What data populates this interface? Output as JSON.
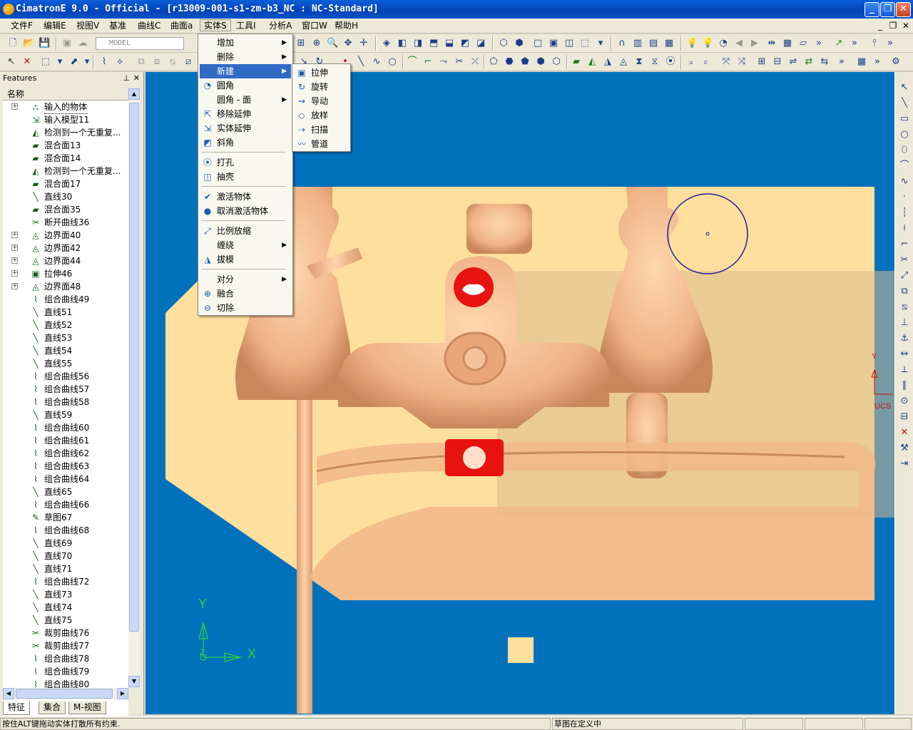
{
  "window": {
    "title": "CimatronE 9.0 - Official - [r13009-001-s1-zm-b3_NC : NC-Standard]",
    "minimize": "_",
    "restore": "❐",
    "close": "✕"
  },
  "menubar": {
    "items": [
      "文件F",
      "编辑E",
      "视图V",
      "基准",
      "曲线C",
      "曲面a",
      "实体S",
      "工具I",
      "分析A",
      "窗口W",
      "帮助H"
    ],
    "mdi_min": "_",
    "mdi_restore": "❐",
    "mdi_close": "✕"
  },
  "toolbar": {
    "model_combo": "MODEL"
  },
  "features": {
    "title": "Features",
    "pin": "⊥",
    "close": "✕",
    "column": "名称",
    "tree": [
      {
        "label": "输入的物体",
        "icon": "input-body-icon",
        "expander": "+"
      },
      {
        "label": "输入模型11",
        "icon": "input-model-icon",
        "expander": ""
      },
      {
        "label": "检测到一个无重复...",
        "icon": "detect-icon",
        "expander": ""
      },
      {
        "label": "混合面13",
        "icon": "blend-surface-icon",
        "expander": ""
      },
      {
        "label": "混合面14",
        "icon": "blend-surface-icon",
        "expander": ""
      },
      {
        "label": "检测到一个无重复...",
        "icon": "detect-icon",
        "expander": ""
      },
      {
        "label": "混合面17",
        "icon": "blend-surface-icon",
        "expander": ""
      },
      {
        "label": "直线30",
        "icon": "line-icon",
        "expander": ""
      },
      {
        "label": "混合面35",
        "icon": "blend-surface-icon",
        "expander": ""
      },
      {
        "label": "断开曲线36",
        "icon": "break-curve-icon",
        "expander": ""
      },
      {
        "label": "边界面40",
        "icon": "boundary-surface-icon",
        "expander": "+"
      },
      {
        "label": "边界面42",
        "icon": "boundary-surface-icon",
        "expander": "+"
      },
      {
        "label": "边界面44",
        "icon": "boundary-surface-icon",
        "expander": "+"
      },
      {
        "label": "拉伸46",
        "icon": "extrude-icon",
        "expander": "+"
      },
      {
        "label": "边界面48",
        "icon": "boundary-surface-icon",
        "expander": "+"
      },
      {
        "label": "组合曲线49",
        "icon": "composite-curve-icon",
        "expander": ""
      },
      {
        "label": "直线51",
        "icon": "line-icon",
        "expander": ""
      },
      {
        "label": "直线52",
        "icon": "line-icon",
        "expander": ""
      },
      {
        "label": "直线53",
        "icon": "line-icon",
        "expander": ""
      },
      {
        "label": "直线54",
        "icon": "line-icon",
        "expander": ""
      },
      {
        "label": "直线55",
        "icon": "line-icon",
        "expander": ""
      },
      {
        "label": "组合曲线56",
        "icon": "composite-curve-icon",
        "expander": ""
      },
      {
        "label": "组合曲线57",
        "icon": "composite-curve-icon",
        "expander": ""
      },
      {
        "label": "组合曲线58",
        "icon": "composite-curve-icon",
        "expander": ""
      },
      {
        "label": "直线59",
        "icon": "line-icon",
        "expander": ""
      },
      {
        "label": "组合曲线60",
        "icon": "composite-curve-icon",
        "expander": ""
      },
      {
        "label": "组合曲线61",
        "icon": "composite-curve-icon",
        "expander": ""
      },
      {
        "label": "组合曲线62",
        "icon": "composite-curve-icon",
        "expander": ""
      },
      {
        "label": "组合曲线63",
        "icon": "composite-curve-icon",
        "expander": ""
      },
      {
        "label": "组合曲线64",
        "icon": "composite-curve-icon",
        "expander": ""
      },
      {
        "label": "直线65",
        "icon": "line-icon",
        "expander": ""
      },
      {
        "label": "组合曲线66",
        "icon": "composite-curve-icon",
        "expander": ""
      },
      {
        "label": "草图67",
        "icon": "sketch-icon",
        "expander": ""
      },
      {
        "label": "组合曲线68",
        "icon": "composite-curve-icon",
        "expander": ""
      },
      {
        "label": "直线69",
        "icon": "line-icon",
        "expander": ""
      },
      {
        "label": "直线70",
        "icon": "line-icon",
        "expander": ""
      },
      {
        "label": "直线71",
        "icon": "line-icon",
        "expander": ""
      },
      {
        "label": "组合曲线72",
        "icon": "composite-curve-icon",
        "expander": ""
      },
      {
        "label": "直线73",
        "icon": "line-icon",
        "expander": ""
      },
      {
        "label": "直线74",
        "icon": "line-icon",
        "expander": ""
      },
      {
        "label": "直线75",
        "icon": "line-icon",
        "expander": ""
      },
      {
        "label": "裁剪曲线76",
        "icon": "trim-curve-icon",
        "expander": ""
      },
      {
        "label": "裁剪曲线77",
        "icon": "trim-curve-icon",
        "expander": ""
      },
      {
        "label": "组合曲线78",
        "icon": "composite-curve-icon",
        "expander": ""
      },
      {
        "label": "组合曲线79",
        "icon": "composite-curve-icon",
        "expander": ""
      },
      {
        "label": "组合曲线80",
        "icon": "composite-curve-icon",
        "expander": ""
      }
    ],
    "tabs": [
      "特征",
      "集合",
      "M-视图"
    ]
  },
  "solid_menu": {
    "items": [
      {
        "label": "增加",
        "submenu": true,
        "icon": ""
      },
      {
        "label": "删除",
        "submenu": true,
        "icon": ""
      },
      {
        "label": "新建",
        "submenu": true,
        "icon": "",
        "highlight": true
      },
      {
        "label": "圆角",
        "submenu": false,
        "icon": "fillet-icon"
      },
      {
        "label": "圆角 - 面",
        "submenu": true,
        "icon": ""
      },
      {
        "label": "移除延伸",
        "submenu": false,
        "icon": "remove-extension-icon"
      },
      {
        "label": "实体延伸",
        "submenu": false,
        "icon": "solid-extension-icon"
      },
      {
        "label": "斜角",
        "submenu": false,
        "icon": "chamfer-icon"
      },
      {
        "label": "打孔",
        "submenu": false,
        "icon": "hole-icon"
      },
      {
        "label": "抽壳",
        "submenu": false,
        "icon": "shell-icon"
      },
      {
        "label": "激活物体",
        "submenu": false,
        "icon": "activate-body-icon"
      },
      {
        "label": "取消激活物体",
        "submenu": false,
        "icon": "deactivate-body-icon"
      },
      {
        "label": "比例放缩",
        "submenu": false,
        "icon": "scale-icon"
      },
      {
        "label": "缠绕",
        "submenu": true,
        "icon": ""
      },
      {
        "label": "拔模",
        "submenu": false,
        "icon": "draft-icon"
      },
      {
        "label": "对分",
        "submenu": true,
        "icon": ""
      },
      {
        "label": "融合",
        "submenu": false,
        "icon": "unite-icon"
      },
      {
        "label": "切除",
        "submenu": false,
        "icon": "cut-icon"
      }
    ]
  },
  "new_submenu": {
    "items": [
      {
        "label": "拉伸",
        "icon": "extrude-icon"
      },
      {
        "label": "旋转",
        "icon": "revolve-icon"
      },
      {
        "label": "导动",
        "icon": "drive-icon"
      },
      {
        "label": "放样",
        "icon": "loft-icon"
      },
      {
        "label": "扫描",
        "icon": "sweep-icon"
      },
      {
        "label": "管道",
        "icon": "pipe-icon"
      }
    ]
  },
  "viewport": {
    "axis_y": "Y",
    "axis_x": "X",
    "axis_z": "Z",
    "ucs_label": "UCS",
    "ucs_y": "Y",
    "colors": {
      "background": "#0072bc",
      "plate": "#ffdf9e",
      "part": "#f0b888",
      "highlight": "#e8120f",
      "axes": "#26d43a",
      "circle": "#1e1ea0"
    }
  },
  "status": {
    "hint": "按住ALT键拖动实体打散所有约束.",
    "mode": "草图在定义中"
  }
}
